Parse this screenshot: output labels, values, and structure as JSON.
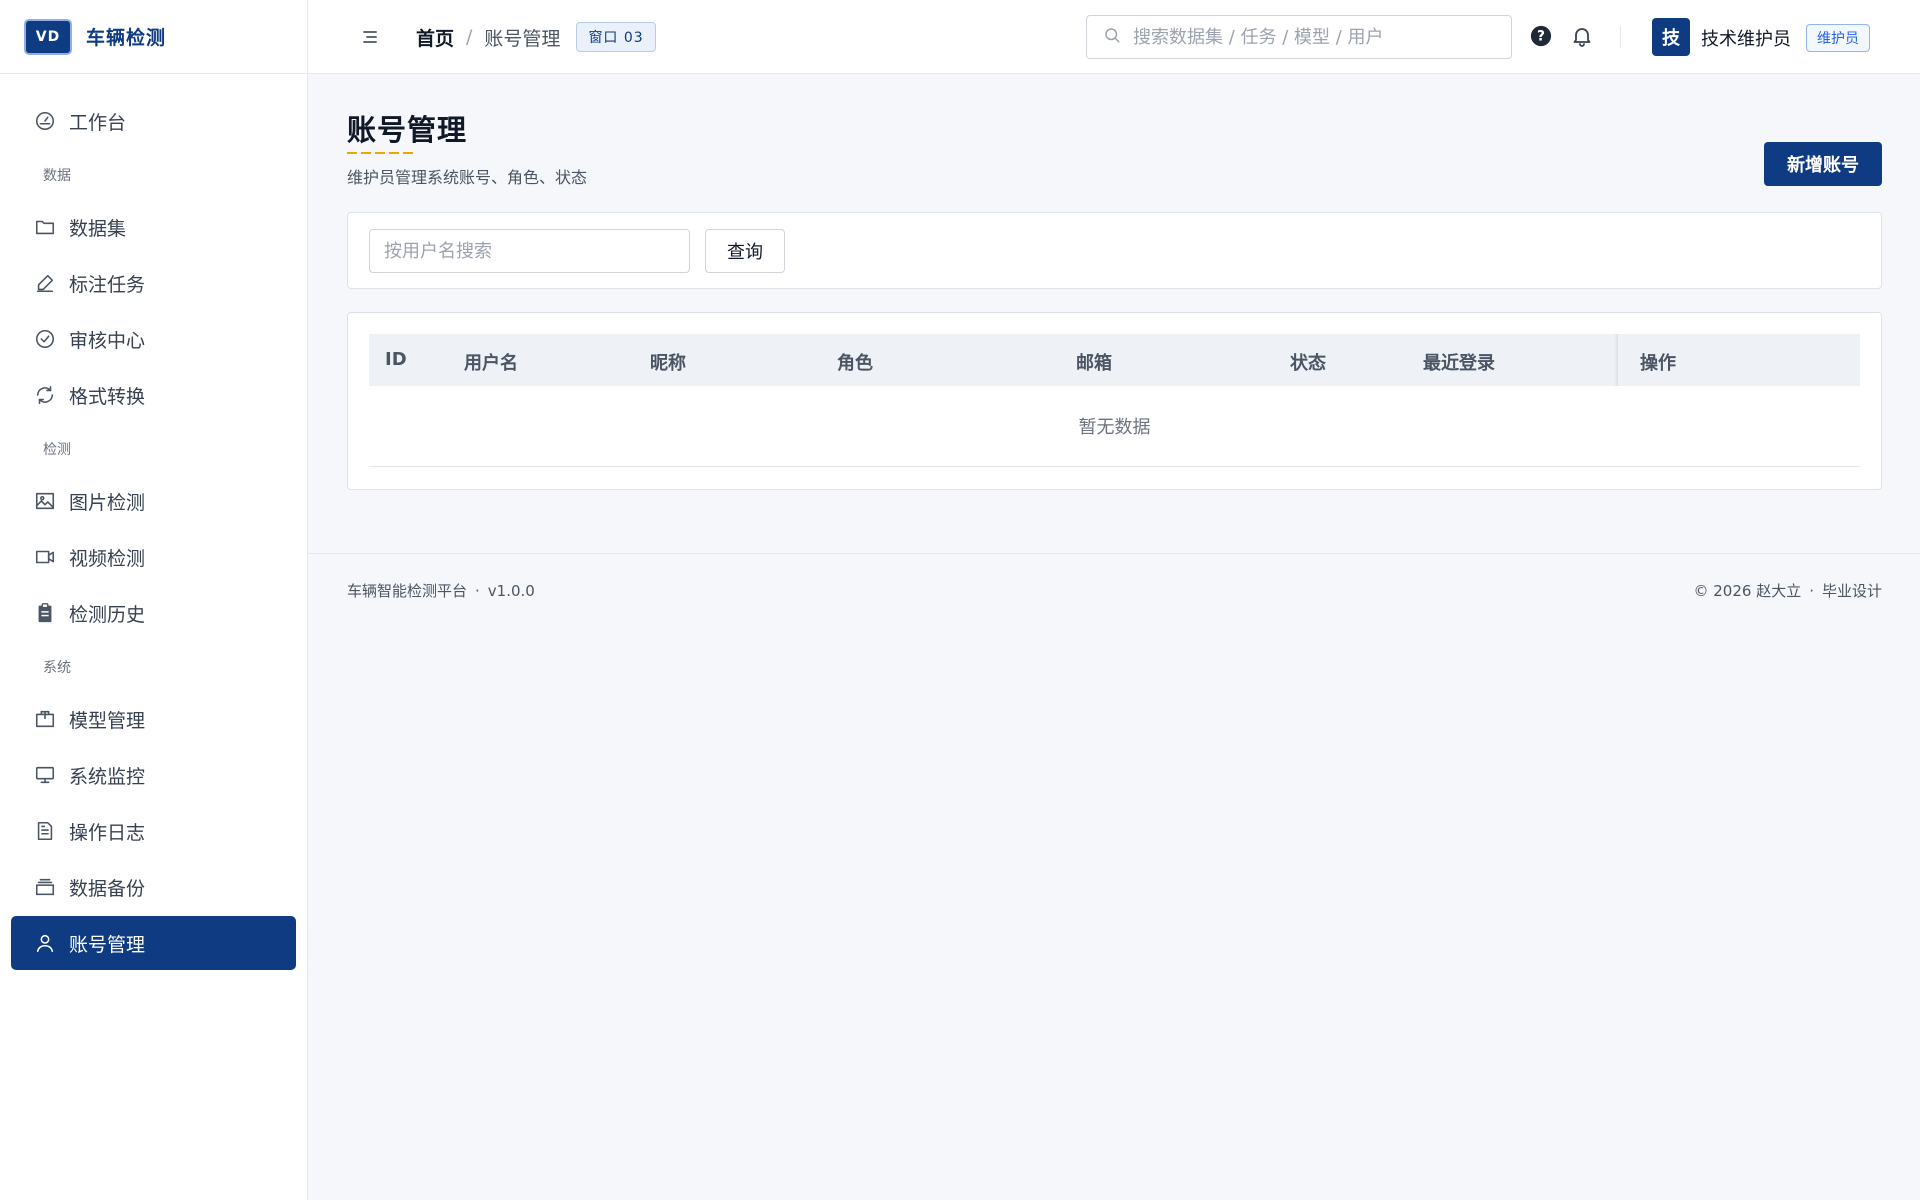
{
  "brand": {
    "logo_text": "VD",
    "name": "车辆检测"
  },
  "sidebar": {
    "items": [
      {
        "type": "item",
        "label": "工作台",
        "icon": "dashboard-icon",
        "name": "sidebar-item-workbench"
      },
      {
        "type": "group",
        "label": "数据"
      },
      {
        "type": "item",
        "label": "数据集",
        "icon": "folder-icon",
        "name": "sidebar-item-datasets"
      },
      {
        "type": "item",
        "label": "标注任务",
        "icon": "pen-icon",
        "name": "sidebar-item-annotation"
      },
      {
        "type": "item",
        "label": "审核中心",
        "icon": "check-circle-icon",
        "name": "sidebar-item-review"
      },
      {
        "type": "item",
        "label": "格式转换",
        "icon": "refresh-icon",
        "name": "sidebar-item-convert"
      },
      {
        "type": "group",
        "label": "检测"
      },
      {
        "type": "item",
        "label": "图片检测",
        "icon": "image-icon",
        "name": "sidebar-item-image-detect"
      },
      {
        "type": "item",
        "label": "视频检测",
        "icon": "video-icon",
        "name": "sidebar-item-video-detect"
      },
      {
        "type": "item",
        "label": "检测历史",
        "icon": "clipboard-icon",
        "name": "sidebar-item-history"
      },
      {
        "type": "group",
        "label": "系统"
      },
      {
        "type": "item",
        "label": "模型管理",
        "icon": "box-icon",
        "name": "sidebar-item-models"
      },
      {
        "type": "item",
        "label": "系统监控",
        "icon": "monitor-icon",
        "name": "sidebar-item-monitor"
      },
      {
        "type": "item",
        "label": "操作日志",
        "icon": "document-icon",
        "name": "sidebar-item-logs"
      },
      {
        "type": "item",
        "label": "数据备份",
        "icon": "stack-icon",
        "name": "sidebar-item-backup"
      },
      {
        "type": "item",
        "label": "账号管理",
        "icon": "user-icon",
        "name": "sidebar-item-accounts",
        "active": true
      }
    ]
  },
  "header": {
    "breadcrumb": {
      "home": "首页",
      "separator": "/",
      "current": "账号管理"
    },
    "window_tag": "窗口 03",
    "search_placeholder": "搜索数据集 / 任务 / 模型 / 用户",
    "user": {
      "avatar_text": "技",
      "name": "技术维护员",
      "role": "维护员"
    }
  },
  "page": {
    "title": "账号管理",
    "subtitle": "维护员管理系统账号、角色、状态",
    "add_button": "新增账号",
    "filter": {
      "placeholder": "按用户名搜索",
      "query_button": "查询"
    },
    "table": {
      "columns": [
        "ID",
        "用户名",
        "昵称",
        "角色",
        "邮箱",
        "状态",
        "最近登录",
        "操作"
      ],
      "empty_text": "暂无数据"
    }
  },
  "footer": {
    "left": "车辆智能检测平台",
    "version": "v1.0.0",
    "copyright": "© 2026 赵大立",
    "right_suffix": "毕业设计",
    "separator": "·"
  },
  "colors": {
    "primary": "#0f3b82",
    "accent_underline": "#f0a500",
    "role_badge": "#2563eb"
  }
}
